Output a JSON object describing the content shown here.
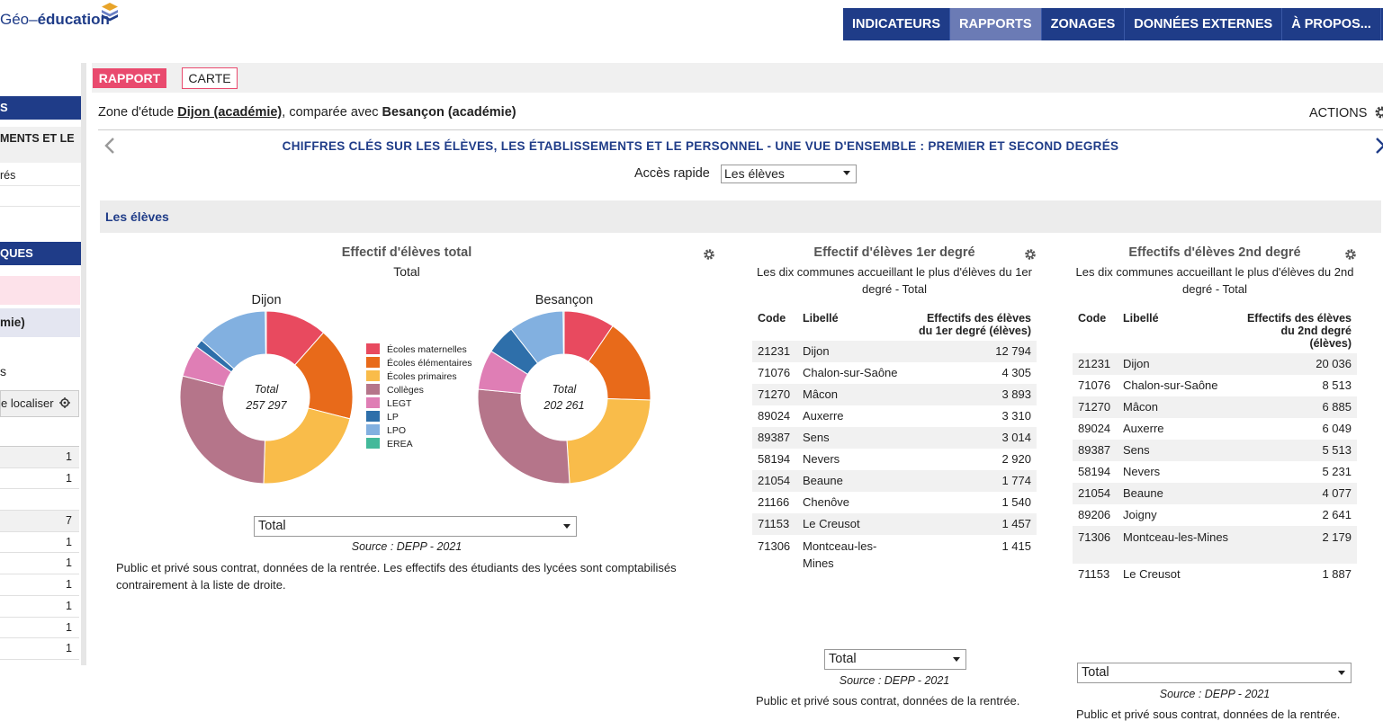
{
  "header": {
    "logo_left": "Géo–",
    "logo_right": "éducation",
    "nav": [
      "INDICATEURS",
      "RAPPORTS",
      "ZONAGES",
      "DONNÉES EXTERNES",
      "À PROPOS..."
    ],
    "active_nav": "RAPPORTS"
  },
  "sidebar": {
    "dark1": "S",
    "text1": "MENTS ET LE",
    "text2": "rés",
    "dark2": "QUES",
    "lav": "mie)",
    "text3": "s",
    "locate": "e localiser",
    "rows": [
      "1",
      "1",
      "",
      "7",
      "1",
      "1",
      "1",
      "1",
      "1",
      "1"
    ]
  },
  "tabs": {
    "rapport": "RAPPORT",
    "carte": "CARTE"
  },
  "zone": {
    "prefix": "Zone d'étude ",
    "study": "Dijon (académie)",
    "middle": ", comparée avec ",
    "compare": "Besançon (académie)",
    "actions": "ACTIONS"
  },
  "report_title": "CHIFFRES CLÉS SUR LES ÉLÈVES, LES ÉTABLISSEMENTS ET LE PERSONNEL - UNE VUE D'ENSEMBLE : PREMIER ET SECOND DEGRÉS",
  "acces_rapide": {
    "label": "Accès rapide",
    "value": "Les élèves"
  },
  "section": "Les élèves",
  "colors": {
    "Écoles maternelles": "#e84a5f",
    "Écoles élémentaires": "#e86a1a",
    "Écoles primaires": "#f9bc4a",
    "Collèges": "#b5758a",
    "LEGT": "#df7eb5",
    "LP": "#2e6faa",
    "LPO": "#82b0e0",
    "EREA": "#43b99a"
  },
  "panel1": {
    "title": "Effectif d'élèves total",
    "subtitle": "Total",
    "select": "Total",
    "source": "Source : DEPP - 2021",
    "note": "Public et privé sous contrat, données de la rentrée. Les effectifs des étudiants des lycées sont comptabilisés contrairement à la liste de droite.",
    "center_label": "Total"
  },
  "chart_data": [
    {
      "type": "pie",
      "title": "Dijon",
      "total": "257 297",
      "categories": [
        "Écoles maternelles",
        "Écoles élémentaires",
        "Écoles primaires",
        "Collèges",
        "LEGT",
        "LP",
        "LPO",
        "EREA"
      ],
      "values": [
        11.5,
        17.5,
        21.5,
        28.5,
        6.0,
        1.5,
        13.3,
        0.2
      ]
    },
    {
      "type": "pie",
      "title": "Besançon",
      "total": "202 261",
      "categories": [
        "Écoles maternelles",
        "Écoles élémentaires",
        "Écoles primaires",
        "Collèges",
        "LEGT",
        "LP",
        "LPO",
        "EREA"
      ],
      "values": [
        9.5,
        16.0,
        23.5,
        27.5,
        7.5,
        5.5,
        10.3,
        0.2
      ]
    }
  ],
  "panel2": {
    "title": "Effectif d'élèves 1er degré",
    "subtitle": "Les dix communes accueillant le plus d'élèves du 1er degré - Total",
    "headers": [
      "Code",
      "Libellé",
      "Effectifs des élèves du 1er degré (élèves)"
    ],
    "rows": [
      [
        "21231",
        "Dijon",
        "12 794"
      ],
      [
        "71076",
        "Chalon-sur-Saône",
        "4 305"
      ],
      [
        "71270",
        "Mâcon",
        "3 893"
      ],
      [
        "89024",
        "Auxerre",
        "3 310"
      ],
      [
        "89387",
        "Sens",
        "3 014"
      ],
      [
        "58194",
        "Nevers",
        "2 920"
      ],
      [
        "21054",
        "Beaune",
        "1 774"
      ],
      [
        "21166",
        "Chenôve",
        "1 540"
      ],
      [
        "71153",
        "Le Creusot",
        "1 457"
      ],
      [
        "71306",
        "Montceau-les-Mines",
        "1 415"
      ]
    ],
    "select": "Total",
    "source": "Source : DEPP - 2021",
    "note": "Public et privé sous contrat, données de la rentrée."
  },
  "panel3": {
    "title": "Effectifs d'élèves 2nd degré",
    "subtitle": "Les dix communes accueillant le plus d'élèves du 2nd degré - Total",
    "headers": [
      "Code",
      "Libellé",
      "Effectifs des élèves du 2nd degré (élèves)"
    ],
    "rows": [
      [
        "21231",
        "Dijon",
        "20 036"
      ],
      [
        "71076",
        "Chalon-sur-Saône",
        "8 513"
      ],
      [
        "71270",
        "Mâcon",
        "6 885"
      ],
      [
        "89024",
        "Auxerre",
        "6 049"
      ],
      [
        "89387",
        "Sens",
        "5 513"
      ],
      [
        "58194",
        "Nevers",
        "5 231"
      ],
      [
        "21054",
        "Beaune",
        "4 077"
      ],
      [
        "89206",
        "Joigny",
        "2 641"
      ],
      [
        "71306",
        "Montceau-les-Mines",
        "2 179"
      ],
      [
        "71153",
        "Le Creusot",
        "1 887"
      ]
    ],
    "select": "Total",
    "source": "Source : DEPP - 2021",
    "note": "Public et privé sous contrat, données de la rentrée."
  }
}
